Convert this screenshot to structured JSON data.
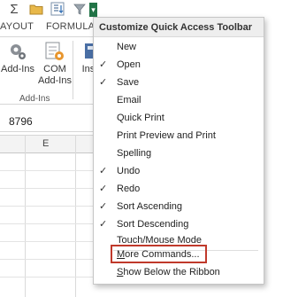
{
  "qat": {
    "sigma_icon": "Σ",
    "dropdown_glyph": "▾"
  },
  "ribbon": {
    "tabs": [
      "AYOUT",
      "FORMULAS"
    ],
    "buttons": {
      "addins": "Add-Ins",
      "com_line1": "COM",
      "com_line2": "Add-Ins",
      "ins_partial": "Inse"
    },
    "group_label": "Add-Ins"
  },
  "formula_bar": {
    "value": "8796"
  },
  "grid": {
    "column_label": "E"
  },
  "menu": {
    "title": "Customize Quick Access Toolbar",
    "check_glyph": "✓",
    "items": [
      {
        "label": "New",
        "checked": false
      },
      {
        "label": "Open",
        "checked": true
      },
      {
        "label": "Save",
        "checked": true
      },
      {
        "label": "Email",
        "checked": false
      },
      {
        "label": "Quick Print",
        "checked": false
      },
      {
        "label": "Print Preview and Print",
        "checked": false
      },
      {
        "label": "Spelling",
        "checked": false
      },
      {
        "label": "Undo",
        "checked": true
      },
      {
        "label": "Redo",
        "checked": true
      },
      {
        "label": "Sort Ascending",
        "checked": true
      },
      {
        "label": "Sort Descending",
        "checked": true
      },
      {
        "label": "Touch/Mouse Mode",
        "checked": false
      },
      {
        "label": "More Commands...",
        "checked": false,
        "access_key": "M"
      },
      {
        "label": "Show Below the Ribbon",
        "checked": false,
        "access_key": "S"
      }
    ],
    "highlight_color": "#c0392b"
  }
}
